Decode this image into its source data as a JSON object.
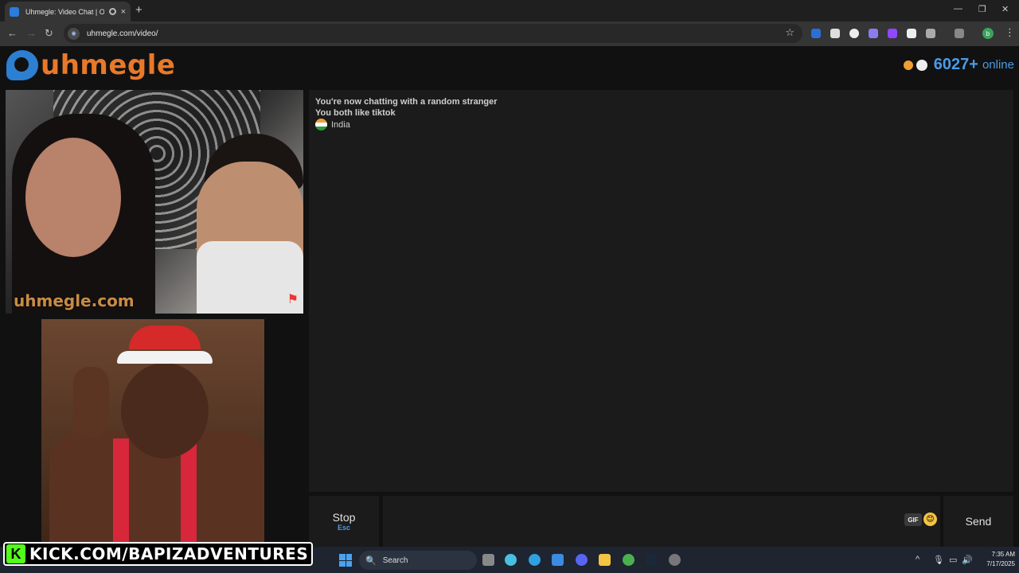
{
  "browser": {
    "tab_title": "Uhmegle: Video Chat | Ome",
    "new_tab": "+",
    "close_tab": "×",
    "url": "uhmegle.com/video/",
    "profile_initial": "b",
    "window": {
      "minimize": "—",
      "restore": "❐",
      "close": "✕"
    },
    "nav": {
      "back": "←",
      "forward": "→",
      "reload": "↻"
    },
    "star": "☆",
    "menu": "⋮"
  },
  "site": {
    "logo_text": "uhmegle",
    "online_count": "6027+",
    "online_label": "online"
  },
  "stranger_video": {
    "watermark": "uhmegle.com",
    "report_icon": "⚑"
  },
  "chat": {
    "messages": [
      "You're now chatting with a random stranger",
      "You both like tiktok"
    ],
    "country": "India"
  },
  "controls": {
    "stop_label": "Stop",
    "stop_key": "Esc",
    "gif_label": "GIF",
    "emoji": "😊",
    "send_label": "Send",
    "message_placeholder": ""
  },
  "overlay": {
    "kick_logo": "K",
    "kick_text": "KICK.COM/BAPIZADVENTURES"
  },
  "taskbar": {
    "search_label": "Search",
    "search_icon": "🔍",
    "time": "7:35 AM",
    "date": "7/17/2025"
  },
  "colors": {
    "accent_orange": "#e8792a",
    "accent_blue": "#4a9be8",
    "kick_green": "#53fc18"
  }
}
